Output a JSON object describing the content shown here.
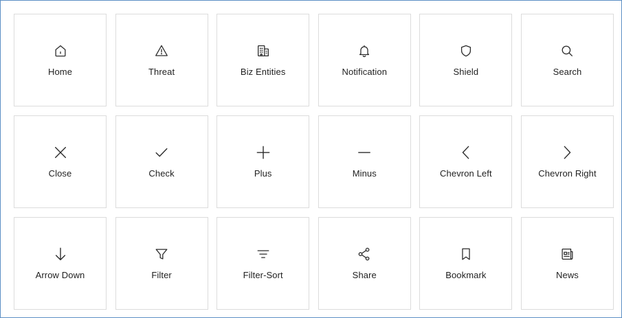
{
  "colors": {
    "frame_border": "#5b8fc4",
    "tile_border": "#dcdcdc",
    "icon": "#2a2a2a",
    "label": "#1f1f1f"
  },
  "icons": [
    {
      "label": "Home",
      "icon": "home-icon"
    },
    {
      "label": "Threat",
      "icon": "threat-icon"
    },
    {
      "label": "Biz Entities",
      "icon": "biz-entities-icon"
    },
    {
      "label": "Notification",
      "icon": "notification-icon"
    },
    {
      "label": "Shield",
      "icon": "shield-icon"
    },
    {
      "label": "Search",
      "icon": "search-icon"
    },
    {
      "label": "Close",
      "icon": "close-icon"
    },
    {
      "label": "Check",
      "icon": "check-icon"
    },
    {
      "label": "Plus",
      "icon": "plus-icon"
    },
    {
      "label": "Minus",
      "icon": "minus-icon"
    },
    {
      "label": "Chevron Left",
      "icon": "chevron-left-icon"
    },
    {
      "label": "Chevron Right",
      "icon": "chevron-right-icon"
    },
    {
      "label": "Arrow Down",
      "icon": "arrow-down-icon"
    },
    {
      "label": "Filter",
      "icon": "filter-icon"
    },
    {
      "label": "Filter-Sort",
      "icon": "filter-sort-icon"
    },
    {
      "label": "Share",
      "icon": "share-icon"
    },
    {
      "label": "Bookmark",
      "icon": "bookmark-icon"
    },
    {
      "label": "News",
      "icon": "news-icon"
    }
  ]
}
